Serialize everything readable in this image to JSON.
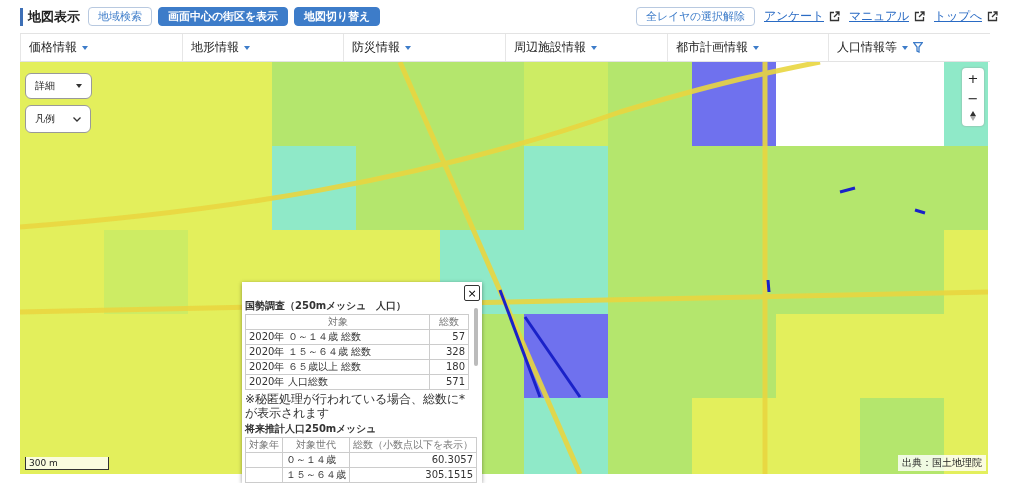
{
  "header": {
    "title": "地図表示",
    "buttons": [
      {
        "label": "地域検索",
        "kind": "outline"
      },
      {
        "label": "画面中心の街区を表示",
        "kind": "primary"
      },
      {
        "label": "地図切り替え",
        "kind": "primary"
      }
    ],
    "clear_button": "全レイヤの選択解除",
    "links": [
      "アンケート",
      "マニュアル",
      "トップへ"
    ]
  },
  "menu": [
    {
      "label": "価格情報",
      "filter": false
    },
    {
      "label": "地形情報",
      "filter": false
    },
    {
      "label": "防災情報",
      "filter": false
    },
    {
      "label": "周辺施設情報",
      "filter": false
    },
    {
      "label": "都市計画情報",
      "filter": false
    },
    {
      "label": "人口情報等",
      "filter": true
    }
  ],
  "map": {
    "controls": [
      {
        "label": "詳細",
        "kind": "caret"
      },
      {
        "label": "凡例",
        "kind": "chevron"
      }
    ],
    "zoom": [
      "+",
      "−"
    ],
    "scale": "300 m",
    "attribution": "出典：国土地理院"
  },
  "popup": {
    "close": "×",
    "census": {
      "title": "国勢調査（250mメッシュ　人口）",
      "columns": [
        "対象",
        "総数"
      ],
      "rows": [
        [
          "2020年 ０～１４歳 総数",
          "57"
        ],
        [
          "2020年 １５～６４歳 総数",
          "328"
        ],
        [
          "2020年 ６５歳以上 総数",
          "180"
        ],
        [
          "2020年 人口総数",
          "571"
        ]
      ]
    },
    "note": "※秘匿処理が行われている場合、総数に*が表示されます",
    "forecast": {
      "title": "将来推計人口250mメッシュ",
      "columns": [
        "対象年",
        "対象世代",
        "総数（小数点以下を表示）"
      ],
      "rows": [
        [
          "",
          "０～１４歳",
          "60.3057"
        ],
        [
          "",
          "１５～６４歳",
          "305.1515"
        ]
      ]
    }
  }
}
